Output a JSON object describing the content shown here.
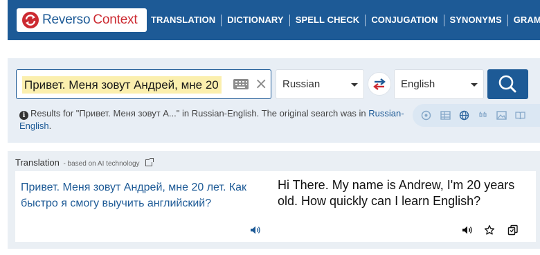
{
  "brand": {
    "name_part1": "Reverso",
    "name_part2": "Context"
  },
  "nav": {
    "items": [
      "TRANSLATION",
      "DICTIONARY",
      "SPELL CHECK",
      "CONJUGATION",
      "SYNONYMS",
      "GRAMMAR"
    ]
  },
  "search": {
    "value": "Привет. Меня зовут Андрей, мне 20",
    "clear_symbol": "×",
    "source_language": "Russian",
    "target_language": "English"
  },
  "info": {
    "icon_glyph": "i",
    "text": "Results for \"Привет. Меня зовут А...\" in Russian-English. The original search was in ",
    "link": "Russian-English",
    "suffix": "."
  },
  "translation": {
    "heading": "Translation",
    "subheading": "- based on AI technology",
    "source_text": "Привет. Меня зовут Андрей, мне 20 лет. Как быстро я смогу выучить английский?",
    "target_text": "Hi There. My name is Andrew, I'm 20 years old. How quickly can I learn English?"
  },
  "icons": {
    "logo": "reverso-logo-icon",
    "keyboard": "keyboard-icon",
    "clear": "close-icon",
    "swap": "swap-languages-icon",
    "search": "search-icon",
    "info": "info-icon",
    "external": "external-link-icon",
    "speaker": "speaker-icon",
    "favorite": "star-icon",
    "copy": "copy-icon",
    "tools": [
      "speech-icon",
      "table-icon",
      "globe-icon",
      "quote-icon",
      "image-icon",
      "book-icon"
    ]
  },
  "colors": {
    "brand_blue": "#1d5a96",
    "brand_red": "#cc2a31",
    "highlight": "#fbefae",
    "panel_bg": "#e8eef5"
  }
}
